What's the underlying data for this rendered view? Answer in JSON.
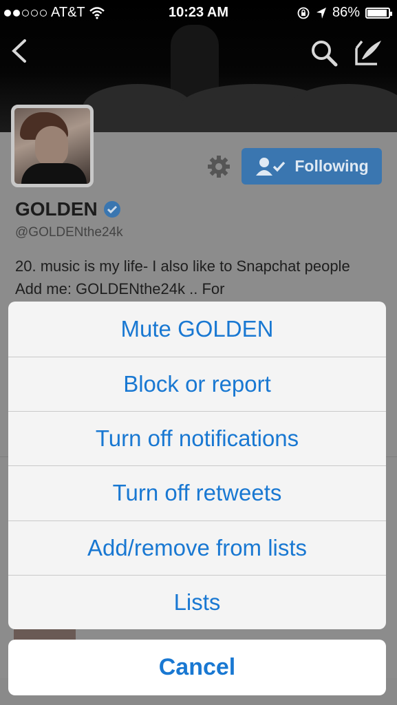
{
  "status_bar": {
    "carrier": "AT&T",
    "time": "10:23 AM",
    "battery": "86%",
    "battery_level": 0.86,
    "signal_bars": 2
  },
  "profile": {
    "name": "GOLDEN",
    "handle": "@GOLDENthe24k",
    "verified": true,
    "bio": "20. music is my life- I also like to Snapchat people Add me: GOLDENthe24k .. For",
    "following_label": "Following"
  },
  "action_sheet": {
    "options": [
      "Mute GOLDEN",
      "Block or report",
      "Turn off notifications",
      "Turn off retweets",
      "Add/remove from lists",
      "Lists"
    ],
    "cancel_label": "Cancel"
  },
  "colors": {
    "accent": "#1978d2",
    "following_button": "#3a76b0"
  },
  "icons": {
    "back": "chevron-left-icon",
    "search": "search-icon",
    "compose": "compose-icon",
    "settings": "gear-icon",
    "verified": "verified-badge-icon"
  }
}
